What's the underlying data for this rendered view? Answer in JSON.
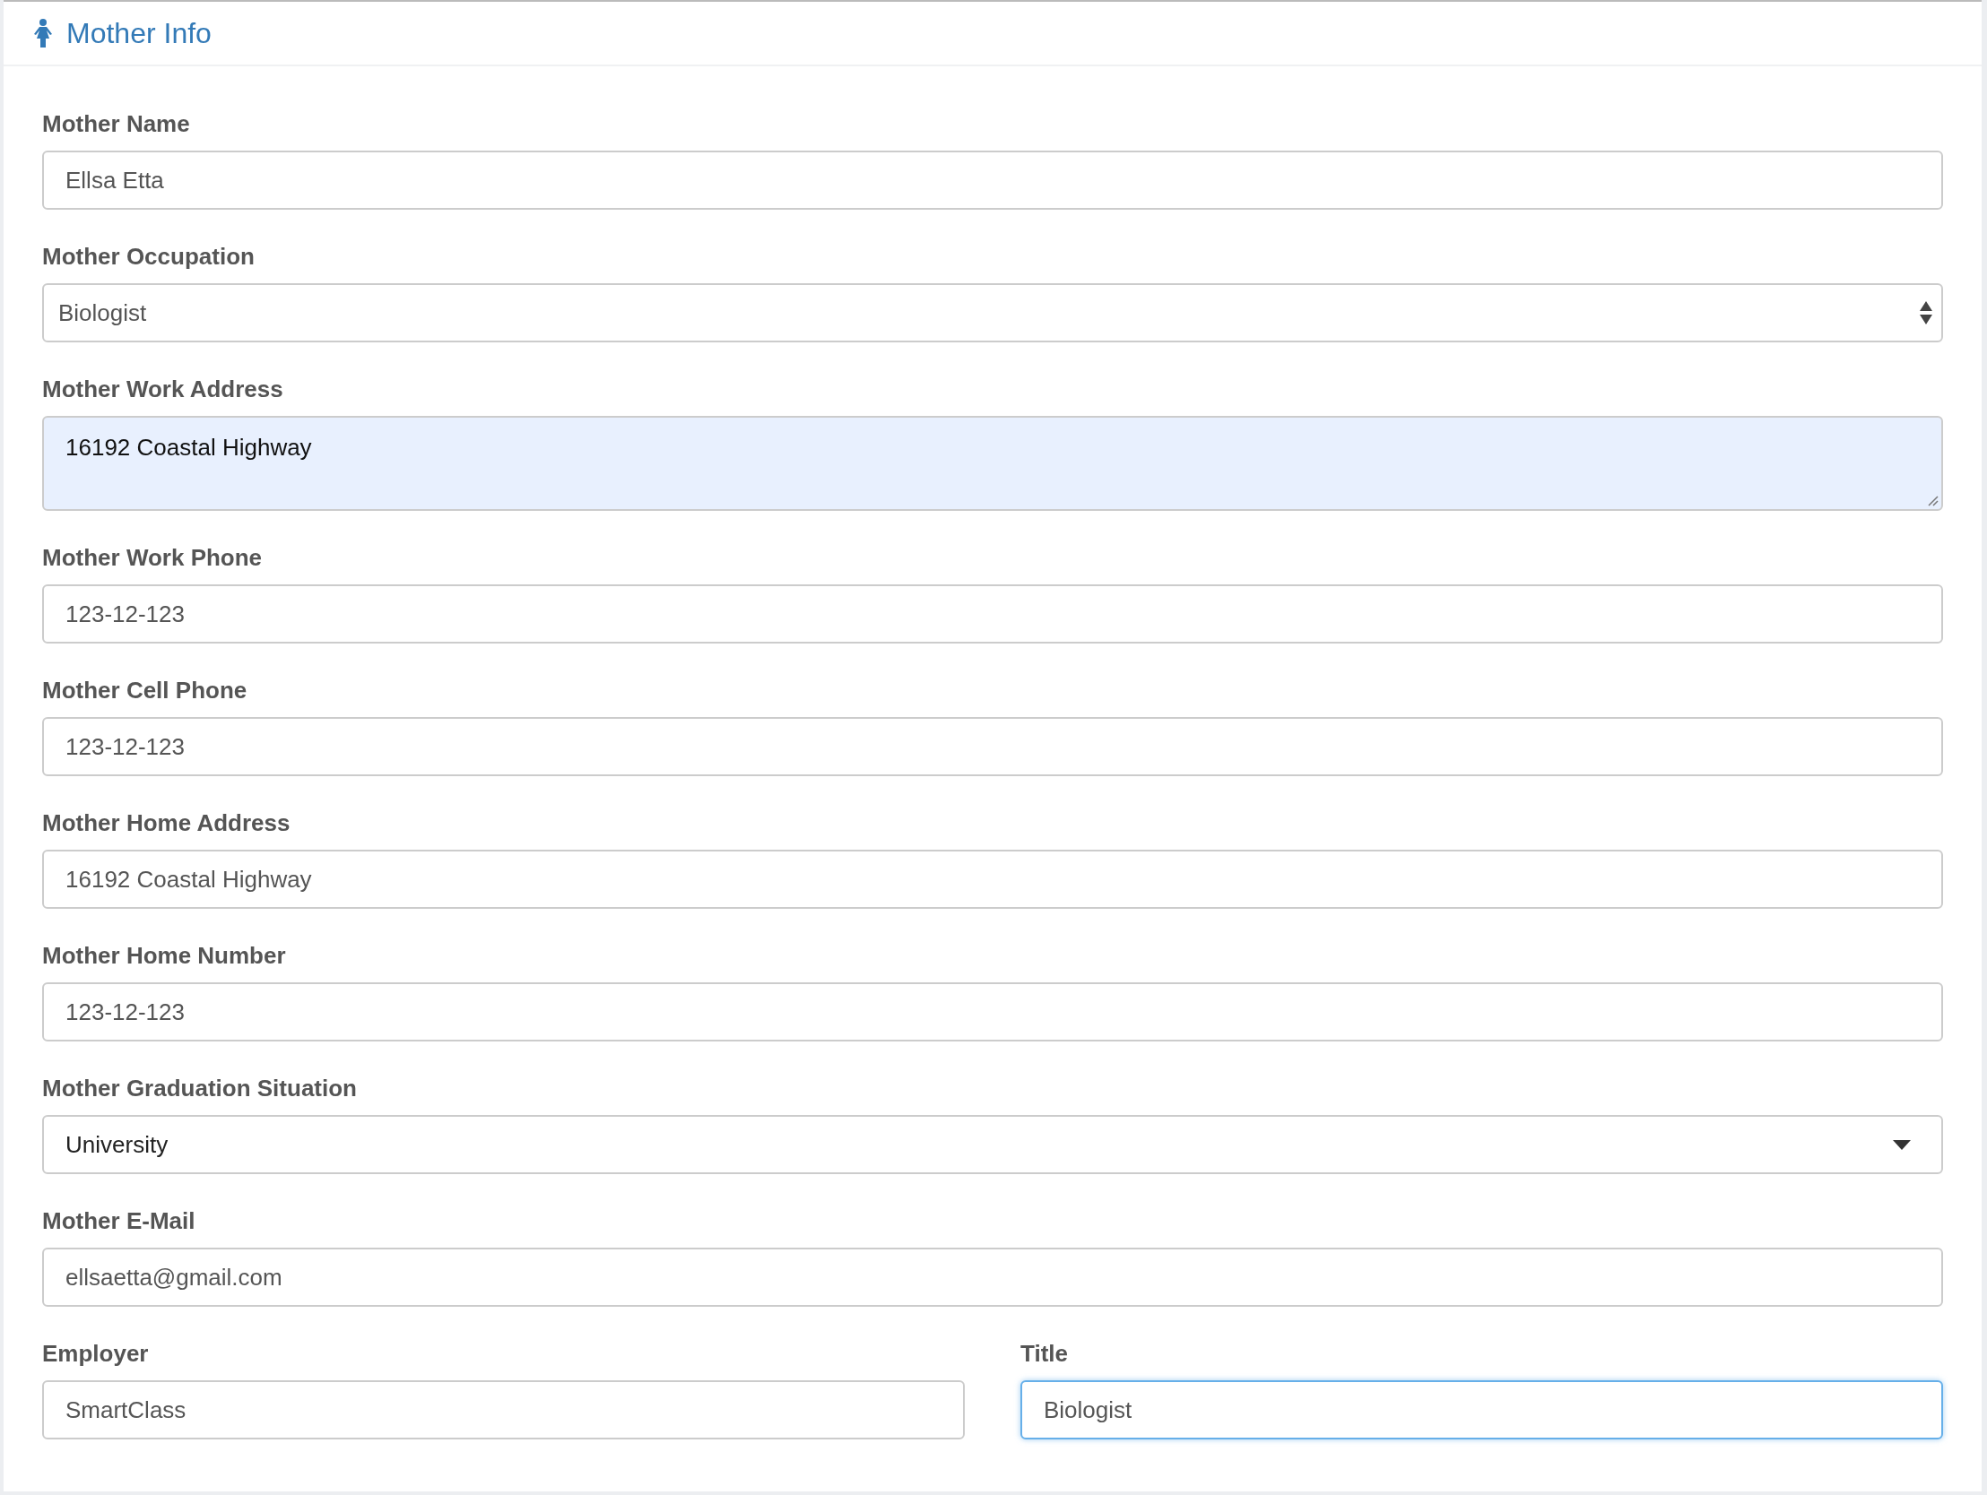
{
  "panel": {
    "title": "Mother Info"
  },
  "rows": [
    {
      "fields": [
        {
          "label": "Mother Name",
          "value": "Ellsa Etta",
          "kind": "text",
          "focused": false,
          "autofilled": false
        }
      ]
    },
    {
      "fields": [
        {
          "label": "Mother Occupation",
          "value": "Biologist",
          "kind": "spinner",
          "focused": false,
          "autofilled": false
        }
      ]
    },
    {
      "fields": [
        {
          "label": "Mother Work Address",
          "value": "16192 Coastal Highway",
          "kind": "textarea",
          "focused": false,
          "autofilled": true
        }
      ]
    },
    {
      "fields": [
        {
          "label": "Mother Work Phone",
          "value": "123-12-123",
          "kind": "text",
          "focused": false,
          "autofilled": false
        }
      ]
    },
    {
      "fields": [
        {
          "label": "Mother Cell Phone",
          "value": "123-12-123",
          "kind": "text",
          "focused": false,
          "autofilled": false
        }
      ]
    },
    {
      "fields": [
        {
          "label": "Mother Home Address",
          "value": "16192 Coastal Highway",
          "kind": "text",
          "focused": false,
          "autofilled": false
        }
      ]
    },
    {
      "fields": [
        {
          "label": "Mother Home Number",
          "value": "123-12-123",
          "kind": "text",
          "focused": false,
          "autofilled": false
        }
      ]
    },
    {
      "fields": [
        {
          "label": "Mother Graduation Situation",
          "value": "University",
          "kind": "dropdown",
          "focused": false,
          "autofilled": false
        }
      ]
    },
    {
      "fields": [
        {
          "label": "Mother E-Mail",
          "value": "ellsaetta@gmail.com",
          "kind": "text",
          "focused": false,
          "autofilled": false
        }
      ]
    },
    {
      "fields": [
        {
          "label": "Employer",
          "value": "SmartClass",
          "kind": "text",
          "focused": false,
          "autofilled": false
        },
        {
          "label": "Title",
          "value": "Biologist",
          "kind": "text",
          "focused": true,
          "autofilled": false
        }
      ]
    }
  ]
}
